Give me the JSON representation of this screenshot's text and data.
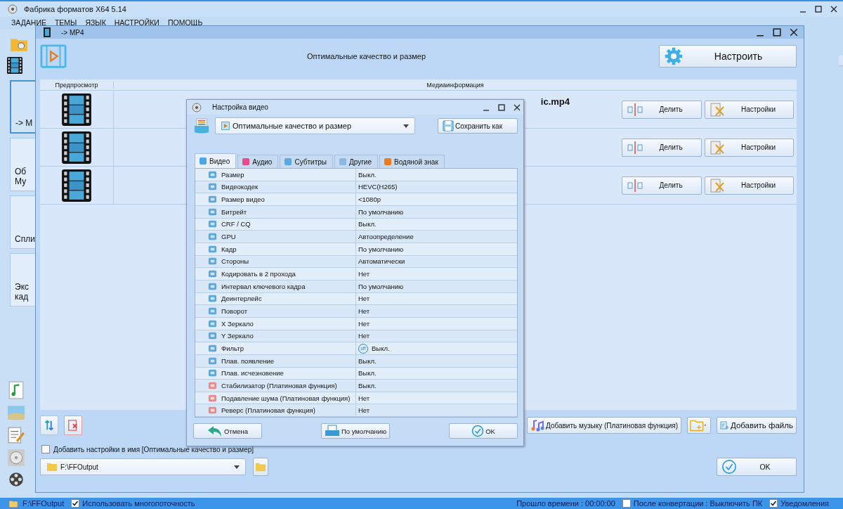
{
  "app": {
    "title": "Фабрика форматов X64 5.14",
    "menu": [
      "ЗАДАНИЕ",
      "ТЕМЫ",
      "ЯЗЫК",
      "НАСТРОЙКИ",
      "ПОМОЩЬ"
    ],
    "sidebar_tiles": [
      {
        "lines": [
          "-> M"
        ],
        "selected": true
      },
      {
        "lines": [
          "Об",
          "Му"
        ],
        "selected": false
      },
      {
        "lines": [
          "Спли"
        ],
        "selected": false
      },
      {
        "lines": [
          "Экс",
          "кад"
        ],
        "selected": false
      }
    ]
  },
  "format_window": {
    "title": "-> MP4",
    "profile": "Оптимальные качество и размер",
    "configure_button": "Настроить",
    "columns": [
      "Предпросмотр",
      "Медиаинформация"
    ],
    "files": [
      {
        "name": "ic.mp4",
        "split_button": "Делить",
        "settings_button": "Настройки"
      },
      {
        "split_button": "Делить",
        "settings_button": "Настройки"
      },
      {
        "split_button": "Делить",
        "settings_button": "Настройки"
      }
    ],
    "add_music_button": "Добавить музыку (Платиновая функция)",
    "add_file_button": "Добавить файль",
    "name_option": {
      "label": "Добавить настройки в имя [Оптимальные качество и размер]",
      "checked": false
    },
    "output_folder": "F:\\FFOutput",
    "ok_button": "OK"
  },
  "video_dialog": {
    "title": "Настройка видео",
    "preset": "Оптимальные качество и размер",
    "save_as_button": "Сохранить как",
    "tabs": [
      {
        "label": "Видео",
        "selected": true
      },
      {
        "label": "Аудио",
        "selected": false
      },
      {
        "label": "Субтитры",
        "selected": false
      },
      {
        "label": "Другие",
        "selected": false
      },
      {
        "label": "Водяной знак",
        "selected": false
      }
    ],
    "rows": [
      {
        "name": "Размер",
        "value": "Выкл."
      },
      {
        "name": "Видеокодек",
        "value": "HEVC(H265)"
      },
      {
        "name": "Размер видео",
        "value": "<1080p"
      },
      {
        "name": "Битрейт",
        "value": "По умолчанию"
      },
      {
        "name": "CRF / CQ",
        "value": "Выкл."
      },
      {
        "name": "GPU",
        "value": "Автоопределение"
      },
      {
        "name": "Кадр",
        "value": "По умолчанию"
      },
      {
        "name": "Стороны",
        "value": "Автоматически"
      },
      {
        "name": "Кодировать в 2 прохода",
        "value": "Нет"
      },
      {
        "name": "Интервал ключевого кадра",
        "value": "По умолчанию"
      },
      {
        "name": "Деинтерлейс",
        "value": "Нет"
      },
      {
        "name": "Поворот",
        "value": "Нет"
      },
      {
        "name": "X Зеркало",
        "value": "Нет"
      },
      {
        "name": "Y Зеркало",
        "value": "Нет"
      },
      {
        "name": "Фильтр",
        "value": "Выкл.",
        "badge": "off"
      },
      {
        "name": "Плав. появление",
        "value": "Выкл."
      },
      {
        "name": "Плав. исчезновение",
        "value": "Выкл."
      },
      {
        "name": "Стабилизатор (Платиновая функция)",
        "value": "Выкл."
      },
      {
        "name": "Подавление шума (Платиновая функция)",
        "value": "Нет"
      },
      {
        "name": "Реверс (Платиновая функция)",
        "value": "Нет"
      }
    ],
    "cancel_button": "Отмена",
    "default_button": "По умолчанию",
    "ok_button": "OK"
  },
  "status_bar": {
    "path": "F:\\FFOutput",
    "multithread": {
      "label": "Использовать многопоточность",
      "checked": true
    },
    "elapsed": "Прошло времени : 00:00:00",
    "shutdown": {
      "label": "После конвертации : Выключить ПК",
      "checked": false
    },
    "notify": {
      "label": "Уведомления",
      "checked": true
    }
  }
}
